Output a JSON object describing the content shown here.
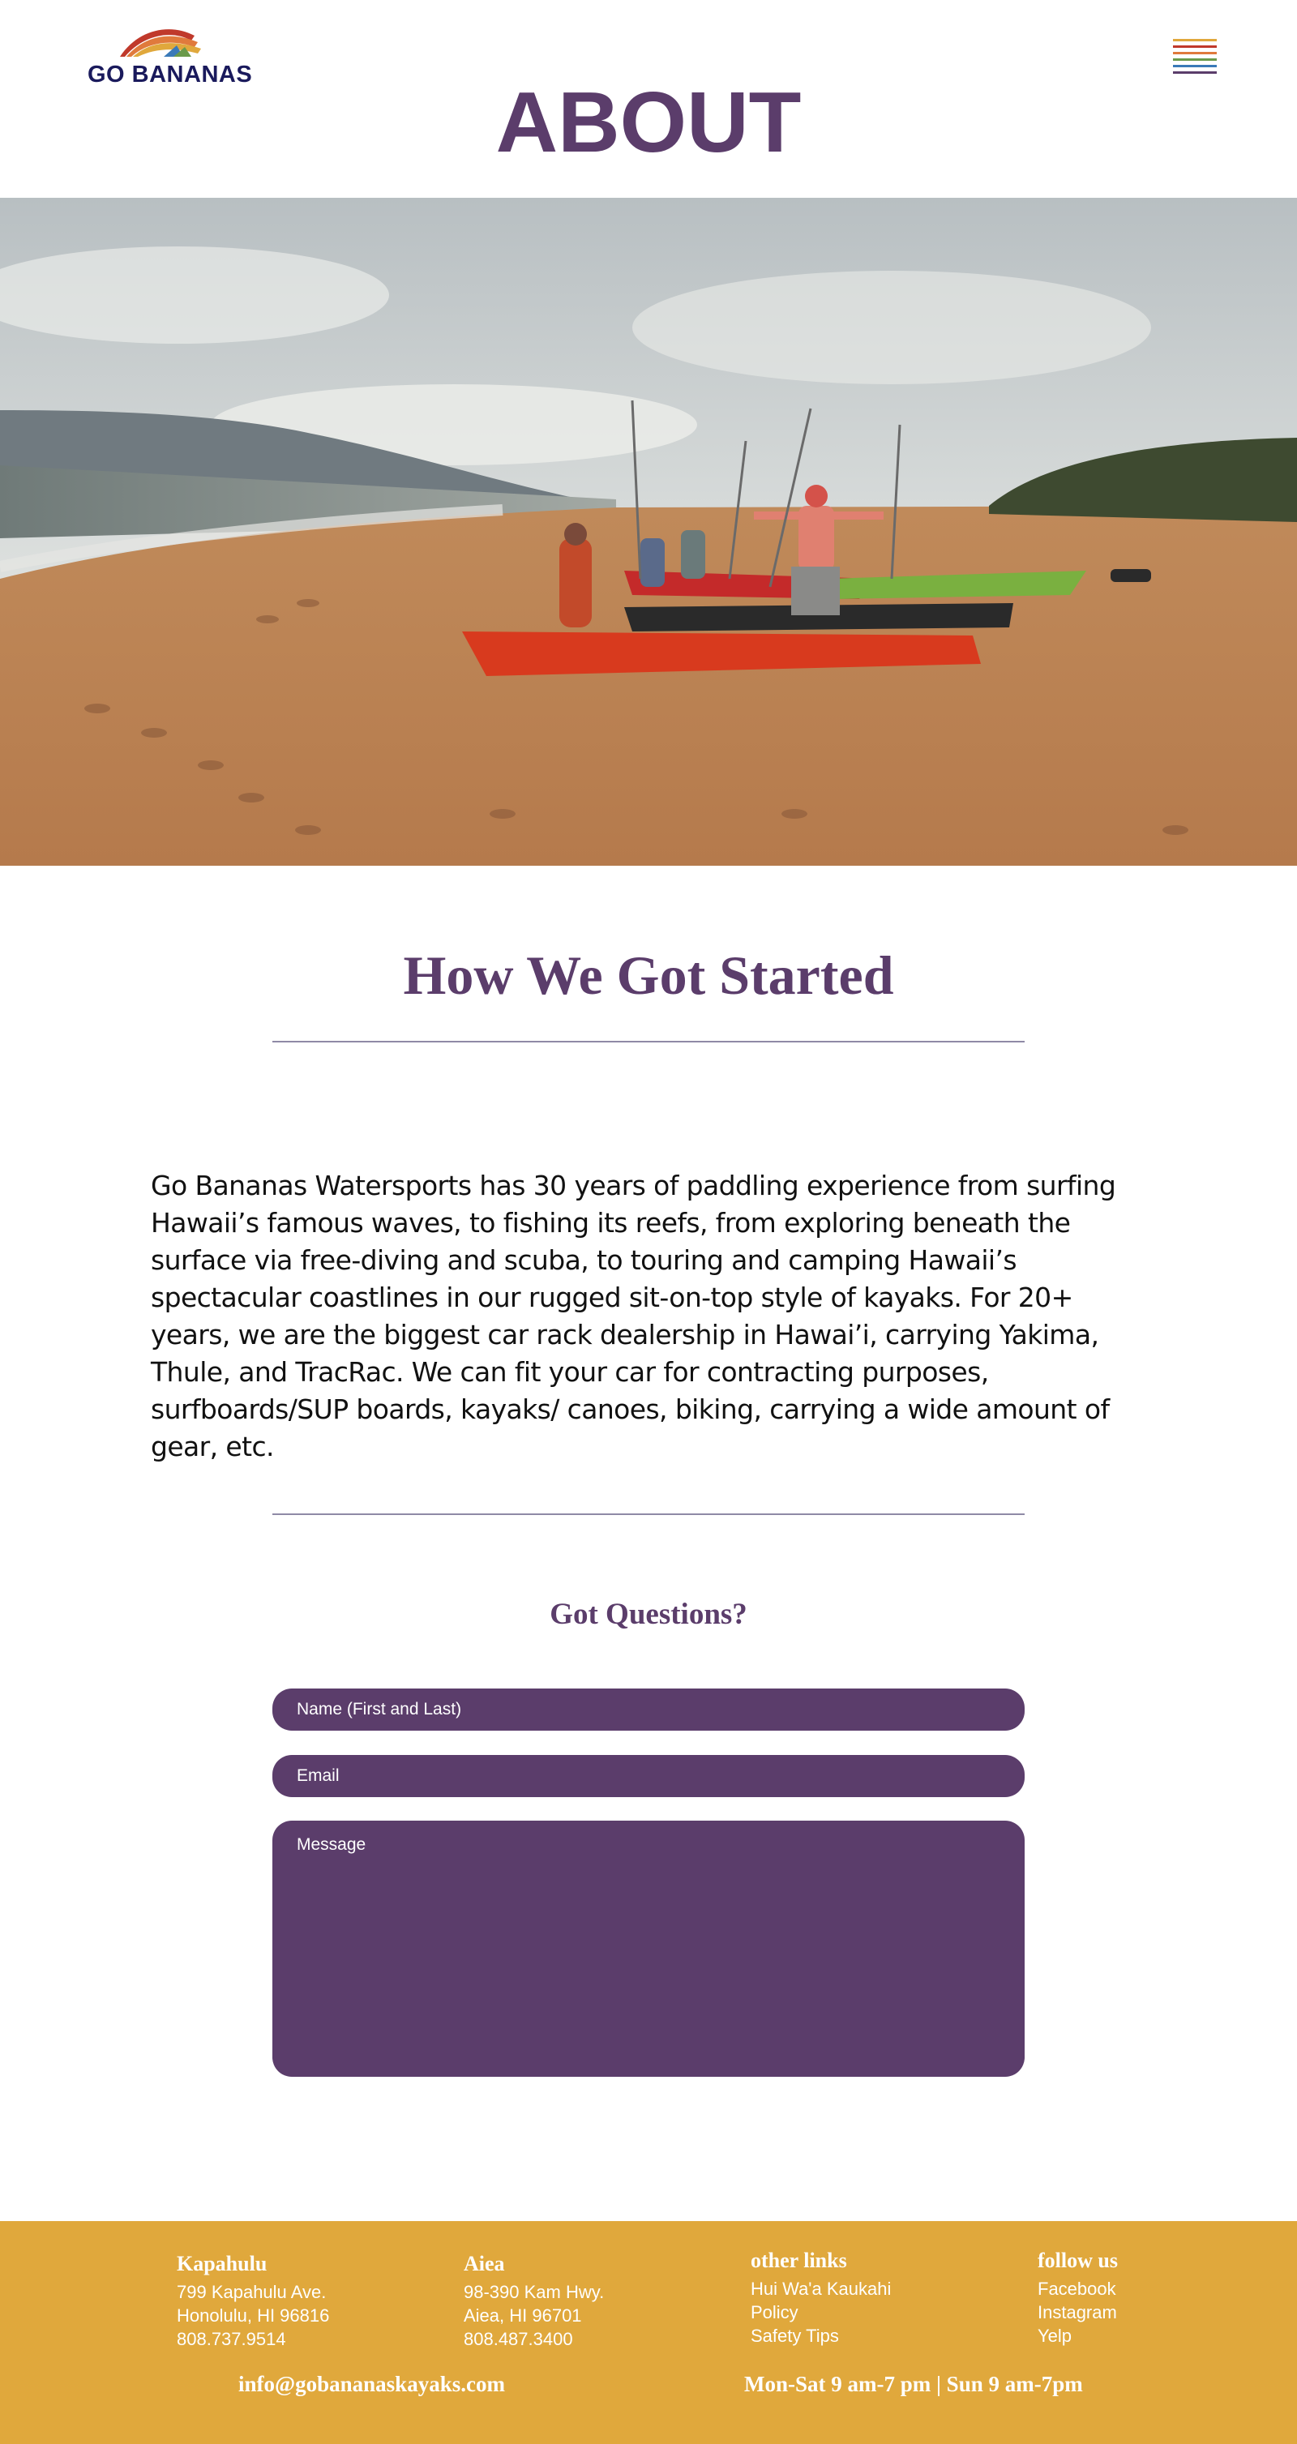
{
  "header": {
    "logo_text": "GO BANANAS",
    "page_title": "ABOUT",
    "menu_icon": "hamburger-menu-icon",
    "menu_stripe_colors": [
      "#e0a83c",
      "#c0392b",
      "#e07a3c",
      "#6a9a4a",
      "#3a7ab8",
      "#5b3d6b"
    ]
  },
  "hero": {
    "image": "beach-kayaks-photo"
  },
  "about": {
    "title": "How We Got Started",
    "body": "Go Bananas Watersports has 30 years of paddling experience from surfing Hawaii’s famous waves, to fishing its reefs, from exploring beneath the surface via free-diving and scuba, to touring and camping Hawaii’s spectacular coastlines in our rugged sit-on-top style of kayaks. For 20+ years, we are the biggest car rack dealership in Hawai’i, carrying Yakima, Thule, and TracRac. We can fit your car for contracting purposes, surfboards/SUP boards, kayaks/ canoes, biking, carrying a wide amount of gear, etc."
  },
  "contact_form": {
    "title": "Got Questions?",
    "name_placeholder": "Name (First and Last)",
    "email_placeholder": "Email",
    "message_placeholder": "Message"
  },
  "footer": {
    "kapahulu": {
      "heading": "Kapahulu",
      "lines": [
        "799 Kapahulu Ave.",
        "Honolulu, HI 96816",
        "808.737.9514"
      ]
    },
    "aiea": {
      "heading": "Aiea",
      "lines": [
        "98-390 Kam Hwy.",
        "Aiea, HI 96701",
        "808.487.3400"
      ]
    },
    "other_links": {
      "heading": "other links",
      "items": [
        "Hui Wa'a Kaukahi",
        "Policy",
        "Safety Tips"
      ]
    },
    "follow_us": {
      "heading": "follow us",
      "items": [
        "Facebook",
        "Instagram",
        "Yelp"
      ]
    },
    "email": "info@gobananaskayaks.com",
    "hours": "Mon-Sat 9 am-7 pm | Sun 9 am-7pm"
  },
  "colors": {
    "brand_purple": "#5b3d6b",
    "footer_gold": "#e0a83c",
    "logo_navy": "#1a1a5c"
  }
}
